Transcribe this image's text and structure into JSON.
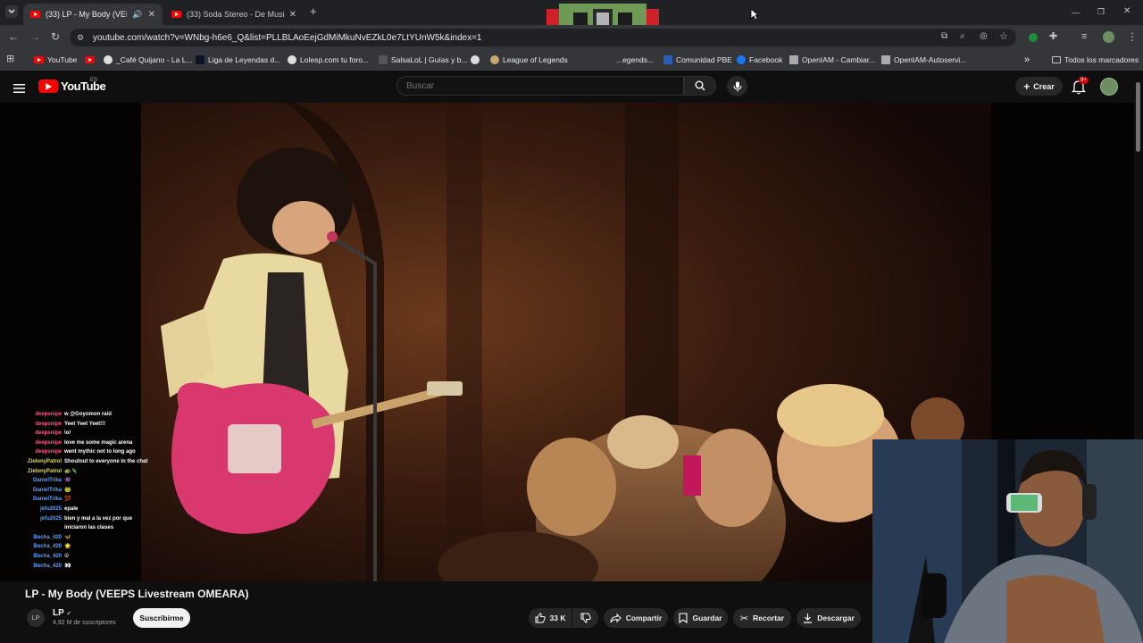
{
  "browser": {
    "tabs": [
      {
        "title": "(33) LP - My Body (VEEPS L",
        "active": true
      },
      {
        "title": "(33) Soda Stereo - De Musica L",
        "active": false
      }
    ],
    "new_tab_label": "+",
    "url": "youtube.com/watch?v=WNbg-h6e6_Q&list=PLLBLAoEejGdMiMkuNvEZkL0e7LtYUnW5k&index=1",
    "bookmarks": [
      {
        "label": "YouTube",
        "icon": "youtube-icon"
      },
      {
        "label": "_Café Quijano - La L...",
        "icon": "globe-icon"
      },
      {
        "label": "Liga de Leyendas d...",
        "icon": "game-icon"
      },
      {
        "label": "Lolesp.com tu foro...",
        "icon": "globe-icon"
      },
      {
        "label": "SalsaLoL | Guías y b...",
        "icon": "site-icon"
      },
      {
        "label": "",
        "icon": "globe-icon"
      },
      {
        "label": "League of Legends",
        "icon": "leaf-icon"
      },
      {
        "label": "...egends...",
        "icon": "site-icon"
      },
      {
        "label": "Comunidad PBE",
        "icon": "site-icon"
      },
      {
        "label": "Facebook",
        "icon": "facebook-icon"
      },
      {
        "label": "OpenIAM - Cambiar...",
        "icon": "site-icon"
      },
      {
        "label": "OpenIAM-Autoservi...",
        "icon": "site-icon"
      }
    ],
    "bookmarks_overflow": "»",
    "all_bookmarks": "Todos los marcadores"
  },
  "youtube": {
    "logo_text": "YouTube",
    "country_code": "ES",
    "search_placeholder": "Buscar",
    "create_label": "Crear",
    "notification_badge": "9+"
  },
  "chat": [
    {
      "user": "deepsnipe",
      "text": "w @Goyomon raid",
      "color": "#ff5a8a"
    },
    {
      "user": "deepsnipe",
      "text": "Yeet Yeet Yeet!!!",
      "color": "#ff5a8a"
    },
    {
      "user": "deepsnipe",
      "text": "\\o/",
      "color": "#ff5a8a"
    },
    {
      "user": "deepsnipe",
      "text": "love me some magic arena",
      "color": "#ff5a8a"
    },
    {
      "user": "deepsnipe",
      "text": "went mythic not to long ago",
      "color": "#ff5a8a"
    },
    {
      "user": "ZielonyPatrol",
      "text": "Shoutout to everyone in the chat",
      "color": "#d9d96c"
    },
    {
      "user": "ZielonyPatrol",
      "text": "🐢🦎",
      "color": "#d9d96c"
    },
    {
      "user": "DanielTrika",
      "text": "👾",
      "color": "#5aa0ff"
    },
    {
      "user": "DanielTrika",
      "text": "🐸",
      "color": "#5aa0ff"
    },
    {
      "user": "DanielTrika",
      "text": "💯",
      "color": "#5aa0ff"
    },
    {
      "user": "jefu2025",
      "text": "epale",
      "color": "#5aa0ff"
    },
    {
      "user": "jefu2025",
      "text": "bien y mal a la vez por que",
      "color": "#5aa0ff"
    },
    {
      "user": "",
      "text": "iniciaron las clases",
      "color": "#5aa0ff"
    },
    {
      "user": "Bocha_420",
      "text": "🦋",
      "color": "#5aa0ff"
    },
    {
      "user": "Bocha_420",
      "text": "🌟",
      "color": "#5aa0ff"
    },
    {
      "user": "Bocha_420",
      "text": "☮",
      "color": "#5aa0ff"
    },
    {
      "user": "Bocha_420",
      "text": "👀",
      "color": "#5aa0ff"
    }
  ],
  "video": {
    "title": "LP - My Body (VEEPS Livestream OMEARA)",
    "channel": "LP",
    "channel_avatar_text": "LP",
    "subscribers": "4,92 M de suscriptores",
    "subscribe_label": "Suscribirme",
    "likes": "33 K",
    "actions": {
      "share": "Compartir",
      "save": "Guardar",
      "clip": "Recortar",
      "download": "Descargar"
    }
  }
}
